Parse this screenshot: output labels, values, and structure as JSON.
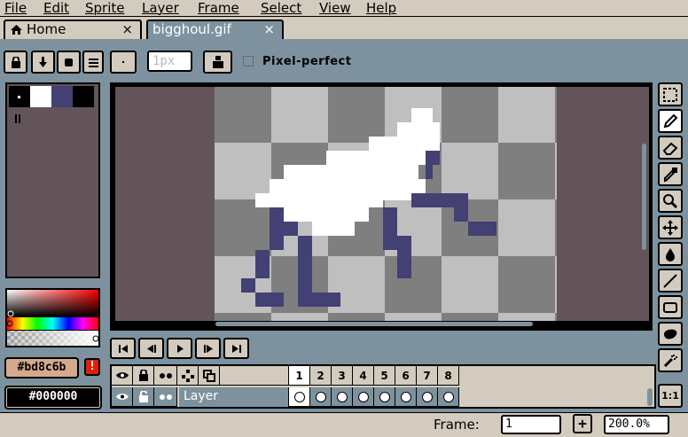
{
  "menu": [
    "File",
    "Edit",
    "Sprite",
    "Layer",
    "Frame",
    "Select",
    "View",
    "Help"
  ],
  "tabs": [
    {
      "label": "Home",
      "close": "×",
      "icon": "home-icon"
    },
    {
      "label": "bigghoul.gif",
      "close": "×"
    }
  ],
  "context_bar": {
    "brush_size_placeholder": "1px",
    "pixel_perfect_label": "Pixel-perfect",
    "pixel_perfect_checked": false
  },
  "palette": {
    "colors": [
      "#000000",
      "#ffffff",
      "#434073",
      "#000000"
    ]
  },
  "colors": {
    "foreground": "#bd8c6b",
    "background": "#000000",
    "warning_label": "!",
    "accent_blue": "#434073",
    "canvas_bg": "#625459",
    "checker_dark": "#7f7f7f",
    "checker_light": "#bfbfbf"
  },
  "timeline": {
    "frames": [
      "1",
      "2",
      "3",
      "4",
      "5",
      "6",
      "7",
      "8"
    ],
    "active_frame": "1",
    "layer_name": "Layer"
  },
  "status": {
    "frame_label": "Frame:",
    "frame_value": "1",
    "add_frame": "+",
    "zoom": "200.0%"
  },
  "tools": [
    "marquee-icon",
    "pencil-icon",
    "eraser-icon",
    "eyedropper-icon",
    "zoom-icon",
    "move-icon",
    "fill-icon",
    "line-icon",
    "rectangle-icon",
    "ellipse-icon",
    "spray-icon",
    "1:1"
  ]
}
